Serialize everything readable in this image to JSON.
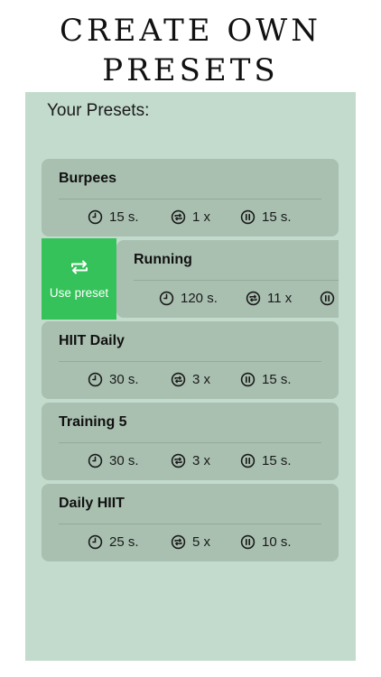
{
  "headline": {
    "line1": "CREATE OWN",
    "line2": "PRESETS"
  },
  "section_title": "Your Presets:",
  "swipe_action": {
    "label": "Use preset",
    "icon": "repeat-icon"
  },
  "presets": [
    {
      "name": "Burpees",
      "time": "15 s.",
      "rounds": "1 x",
      "rest": "15 s."
    },
    {
      "name": "Running",
      "time": "120 s.",
      "rounds": "11 x",
      "rest": ""
    },
    {
      "name": "HIIT Daily",
      "time": "30 s.",
      "rounds": "3 x",
      "rest": "15 s."
    },
    {
      "name": "Training 5",
      "time": "30 s.",
      "rounds": "3 x",
      "rest": "15 s."
    },
    {
      "name": "Daily HIIT",
      "time": "25 s.",
      "rounds": "5 x",
      "rest": "10 s."
    }
  ],
  "colors": {
    "panel": "#c2dbcd",
    "card": "#a9c0b0",
    "accent_green": "#35c25a"
  }
}
